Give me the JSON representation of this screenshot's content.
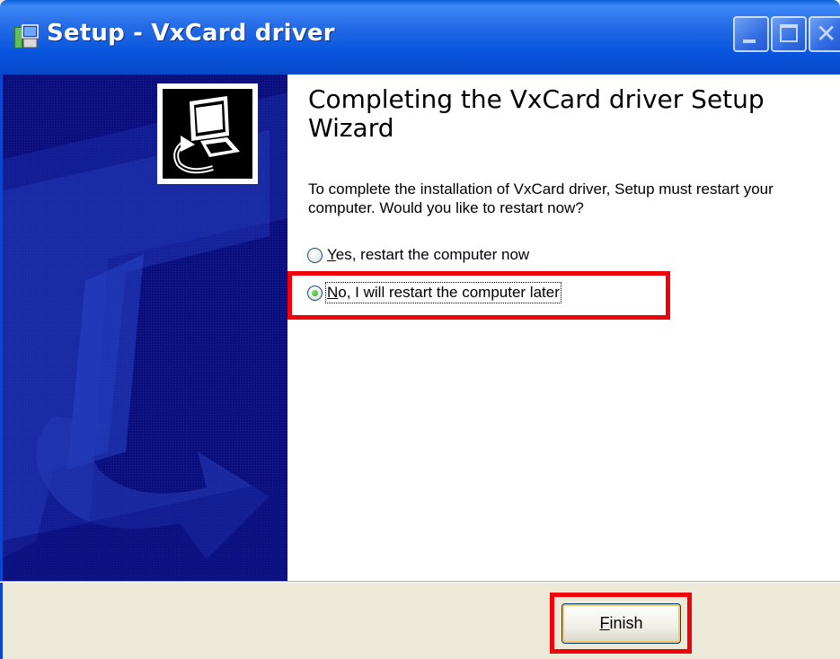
{
  "window": {
    "title": "Setup - VxCard driver",
    "titlebar_color": "#0855dd"
  },
  "title_buttons": {
    "minimize_icon": "minimize-icon",
    "maximize_icon": "maximize-icon",
    "close_glyph": "✕"
  },
  "wizard": {
    "heading": "Completing the VxCard driver Setup Wizard",
    "message": "To complete the installation of VxCard driver, Setup must restart your computer. Would you like to restart now?",
    "options": [
      {
        "mnemonic": "Y",
        "rest": "es, restart the computer now",
        "checked": false
      },
      {
        "mnemonic": "N",
        "rest": "o, I will restart the computer later",
        "checked": true
      }
    ],
    "side_panel_color": "#0b0e7d"
  },
  "footer": {
    "finish_mnemonic": "F",
    "finish_rest": "inish"
  },
  "highlight_color": "#f0000a"
}
